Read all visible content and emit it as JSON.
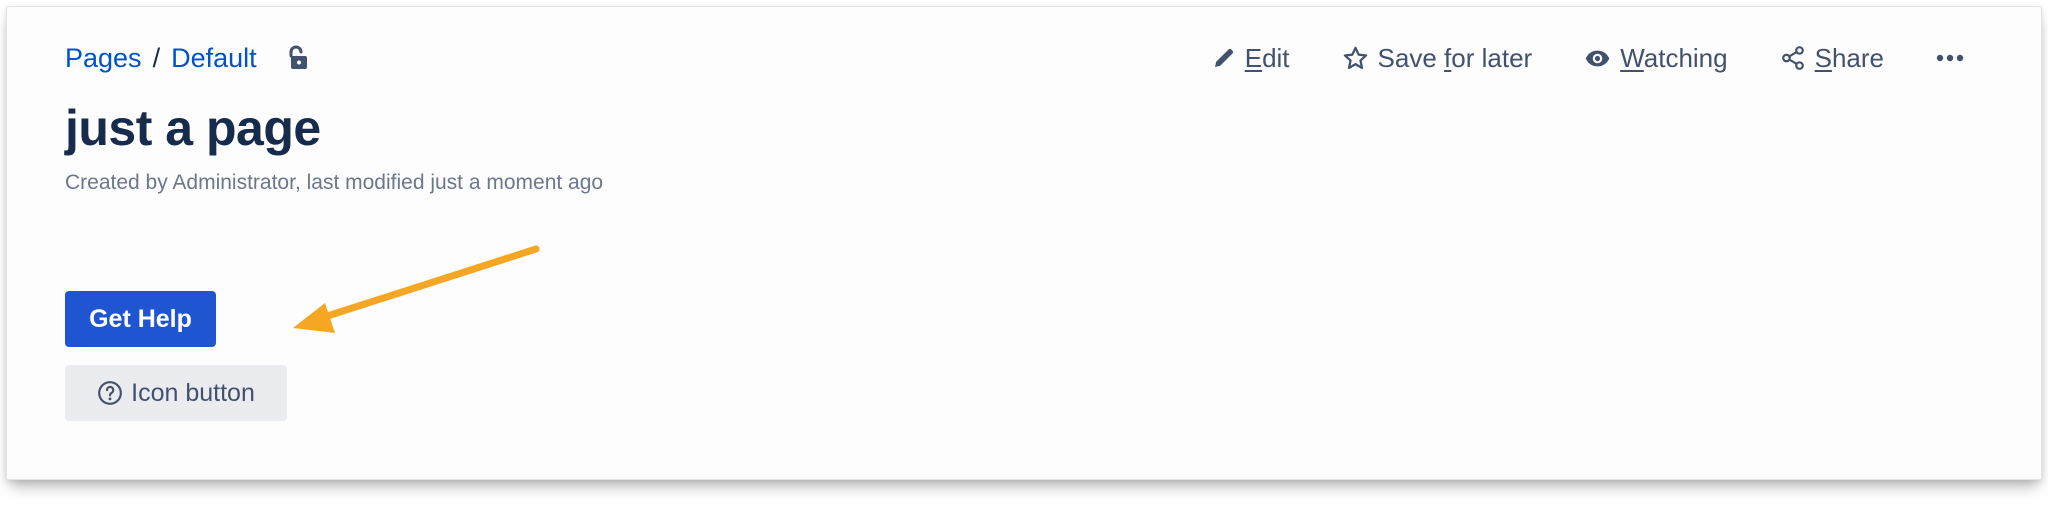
{
  "breadcrumb": {
    "items": [
      "Pages",
      "Default"
    ],
    "separator": "/",
    "lock_icon": "unlock-icon"
  },
  "actions": {
    "edit": {
      "label_first": "E",
      "label_rest": "dit",
      "icon": "pencil-icon"
    },
    "save": {
      "label_pre": "Save ",
      "label_u": "f",
      "label_post": "or later",
      "icon": "star-icon"
    },
    "watch": {
      "label_u": "W",
      "label_rest": "atching",
      "icon": "eye-icon"
    },
    "share": {
      "label_u": "S",
      "label_rest": "hare",
      "icon": "share-icon"
    },
    "more": {
      "icon": "more-horizontal-icon"
    }
  },
  "page": {
    "title": "just a page",
    "byline": "Created by Administrator, last modified just a moment ago"
  },
  "buttons": {
    "primary": "Get Help",
    "secondary": "Icon button",
    "secondary_icon": "question-circle-icon"
  },
  "annotation": {
    "icon": "arrow-annotation-icon",
    "color": "#f5a623"
  },
  "colors": {
    "link": "#0052cc",
    "title": "#172b4d",
    "muted": "#6b778c",
    "primary_button": "#1f55d1",
    "secondary_button": "#ebecf0"
  }
}
